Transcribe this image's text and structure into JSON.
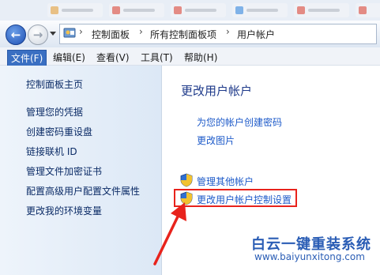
{
  "window": {
    "address_path": [
      "控制面板",
      "所有控制面板项",
      "用户帐户"
    ]
  },
  "menubar": {
    "items": [
      "文件(F)",
      "编辑(E)",
      "查看(V)",
      "工具(T)",
      "帮助(H)"
    ],
    "active_index": 0
  },
  "left_pane": {
    "home_link": "控制面板主页",
    "links": [
      "管理您的凭据",
      "创建密码重设盘",
      "链接联机 ID",
      "管理文件加密证书",
      "配置高级用户配置文件属性",
      "更改我的环境变量"
    ]
  },
  "main": {
    "title": "更改用户帐户",
    "tasks": [
      "为您的帐户创建密码",
      "更改图片"
    ],
    "shield_tasks": [
      "管理其他帐户",
      "更改用户帐户控制设置"
    ],
    "highlighted_task_index": 1
  },
  "watermark": {
    "title": "白云一键重装系统",
    "url": "www.baiyunxitong.com"
  },
  "colors": {
    "accent": "#1d5ac9",
    "highlight": "#e8231c",
    "brand": "#2a5db5"
  }
}
